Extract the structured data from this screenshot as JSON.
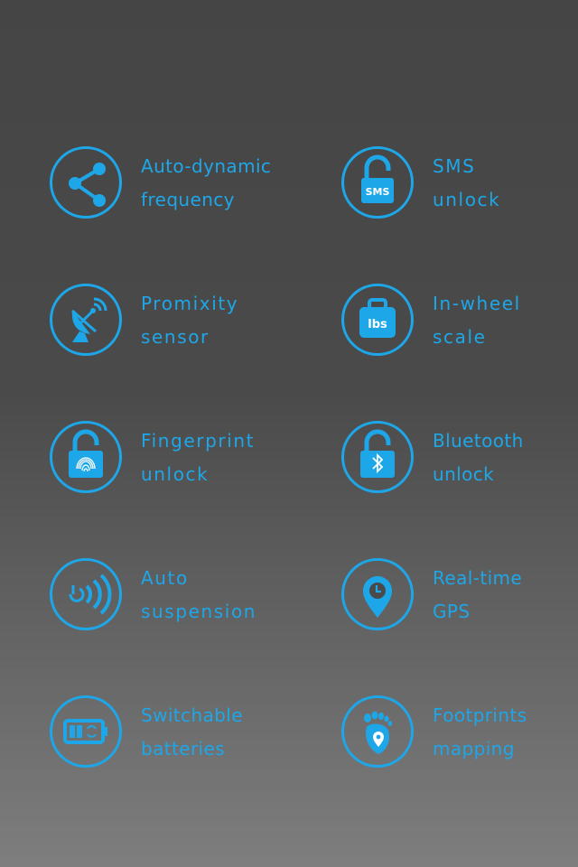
{
  "features": [
    {
      "id": "auto-dynamic-frequency",
      "icon": "share-icon",
      "line1": "Auto-dynamic",
      "line2": "frequency"
    },
    {
      "id": "sms-unlock",
      "icon": "sms-lock-icon",
      "icon_text": "SMS",
      "line1": "SMS",
      "line2": "unlock"
    },
    {
      "id": "proximity-sensor",
      "icon": "satellite-dish-icon",
      "line1": "Promixity",
      "line2": "sensor"
    },
    {
      "id": "in-wheel-scale",
      "icon": "weight-scale-icon",
      "icon_text": "lbs",
      "line1": "In-wheel",
      "line2": "scale"
    },
    {
      "id": "fingerprint-unlock",
      "icon": "fingerprint-lock-icon",
      "line1": "Fingerprint",
      "line2": "unlock"
    },
    {
      "id": "bluetooth-unlock",
      "icon": "bluetooth-lock-icon",
      "line1": "Bluetooth",
      "line2": "unlock"
    },
    {
      "id": "auto-suspension",
      "icon": "power-signal-icon",
      "line1": "Auto",
      "line2": "suspension"
    },
    {
      "id": "real-time-gps",
      "icon": "map-pin-clock-icon",
      "line1": "Real-time",
      "line2": "GPS"
    },
    {
      "id": "switchable-batteries",
      "icon": "battery-swap-icon",
      "line1": "Switchable",
      "line2": "batteries"
    },
    {
      "id": "footprints-mapping",
      "icon": "footprint-pin-icon",
      "line1": "Footprints",
      "line2": "mapping"
    }
  ],
  "colors": {
    "accent": "#1ea7e8",
    "background_top": "#454545",
    "background_bottom": "#7e7e7e"
  }
}
